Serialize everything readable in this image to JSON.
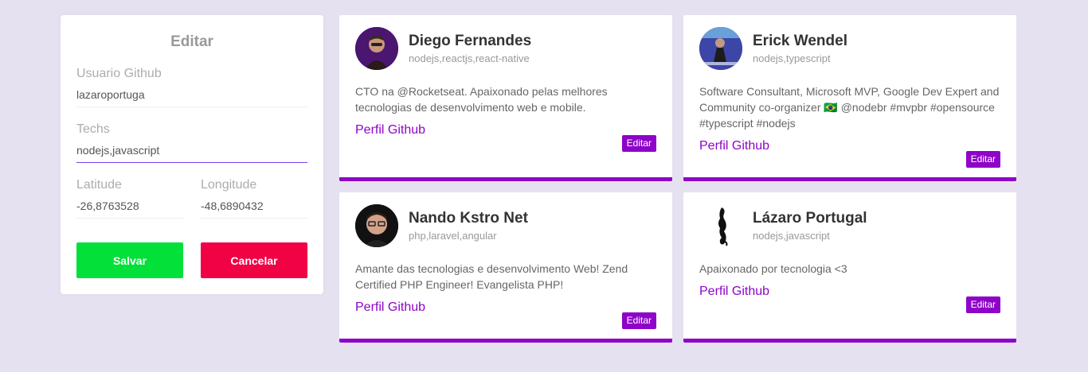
{
  "form": {
    "title": "Editar",
    "github_label": "Usuario Github",
    "github_value": "lazaroportuga",
    "techs_label": "Techs",
    "techs_value": "nodejs,javascript",
    "latitude_label": "Latitude",
    "latitude_value": "-26,8763528",
    "longitude_label": "Longitude",
    "longitude_value": "-48,6890432",
    "save_label": "Salvar",
    "cancel_label": "Cancelar"
  },
  "colors": {
    "background": "#e5e1f0",
    "accent": "#8e03c8",
    "save": "#04e03a",
    "cancel": "#f00245"
  },
  "devs": [
    {
      "name": "Diego Fernandes",
      "techs": "nodejs,reactjs,react-native",
      "bio": "CTO na @Rocketseat. Apaixonado pelas melhores tecnologias de desenvolvimento web e mobile.",
      "link_label": "Perfil Github",
      "edit_label": "Editar"
    },
    {
      "name": "Erick Wendel",
      "techs": "nodejs,typescript",
      "bio": "Software Consultant, Microsoft MVP, Google Dev Expert and Community co-organizer 🇧🇷 @nodebr #mvpbr #opensource #typescript #nodejs",
      "link_label": "Perfil Github",
      "edit_label": "Editar"
    },
    {
      "name": "Nando Kstro Net",
      "techs": "php,laravel,angular",
      "bio": "Amante das tecnologias e desenvolvimento Web! Zend Certified PHP Engineer! Evangelista PHP!",
      "link_label": "Perfil Github",
      "edit_label": "Editar"
    },
    {
      "name": "Lázaro Portugal",
      "techs": "nodejs,javascript",
      "bio": "Apaixonado por tecnologia <3",
      "link_label": "Perfil Github",
      "edit_label": "Editar"
    }
  ]
}
